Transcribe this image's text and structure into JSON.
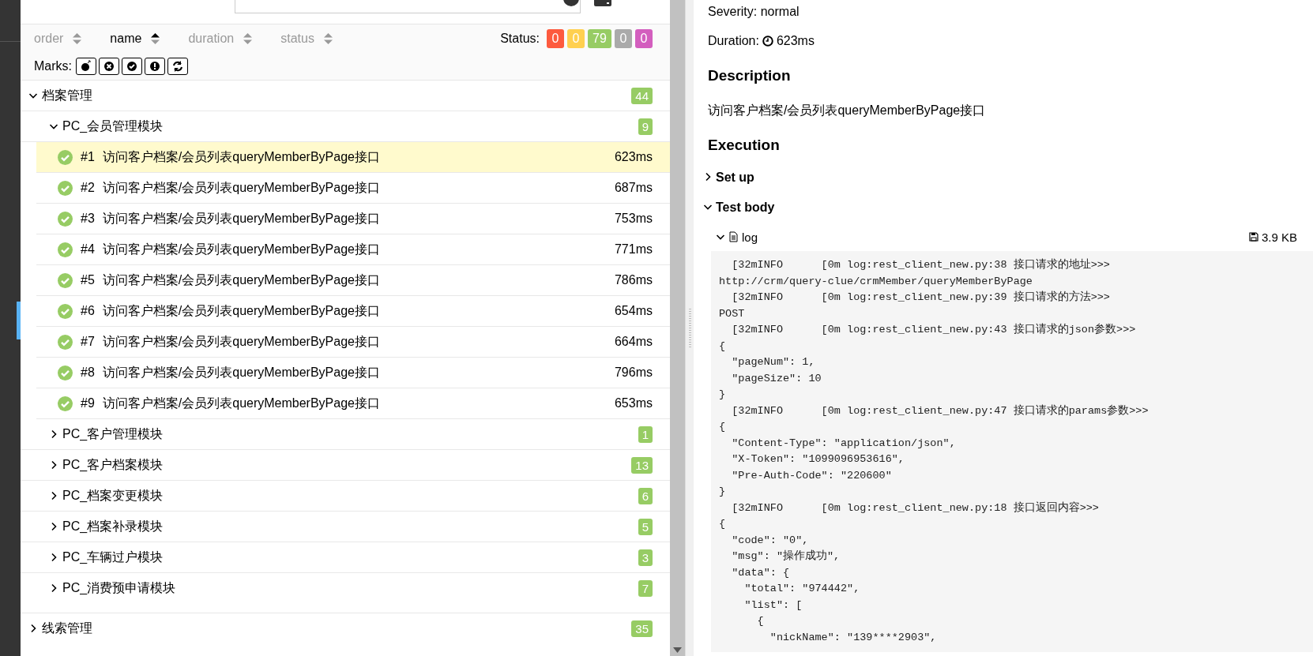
{
  "sorters": [
    {
      "label": "order",
      "selected": false
    },
    {
      "label": "name",
      "selected": true
    },
    {
      "label": "duration",
      "selected": false
    },
    {
      "label": "status",
      "selected": false
    }
  ],
  "status_filter": {
    "label": "Status:",
    "counts": [
      {
        "value": "0",
        "color": "#fd5a3e"
      },
      {
        "value": "0",
        "color": "#ffd050"
      },
      {
        "value": "79",
        "color": "#97cc64"
      },
      {
        "value": "0",
        "color": "#aaaaaa"
      },
      {
        "value": "0",
        "color": "#d35ebe"
      }
    ]
  },
  "marks": {
    "label": "Marks:",
    "buttons": [
      {
        "kind": "flaky"
      },
      {
        "kind": "new-failed"
      },
      {
        "kind": "new-passed"
      },
      {
        "kind": "new-broken"
      },
      {
        "kind": "retries"
      }
    ]
  },
  "tree": [
    {
      "name": "档案管理",
      "count": "44",
      "expanded": true,
      "children": [
        {
          "name": "PC_会员管理模块",
          "count": "9",
          "expanded": true,
          "tests": [
            {
              "index": "#1",
              "name": "访问客户档案/会员列表queryMemberByPage接口",
              "duration": "623ms",
              "kind": "passed",
              "selected": true
            },
            {
              "index": "#2",
              "name": "访问客户档案/会员列表queryMemberByPage接口",
              "duration": "687ms",
              "kind": "passed",
              "selected": false
            },
            {
              "index": "#3",
              "name": "访问客户档案/会员列表queryMemberByPage接口",
              "duration": "753ms",
              "kind": "passed",
              "selected": false
            },
            {
              "index": "#4",
              "name": "访问客户档案/会员列表queryMemberByPage接口",
              "duration": "771ms",
              "kind": "passed",
              "selected": false
            },
            {
              "index": "#5",
              "name": "访问客户档案/会员列表queryMemberByPage接口",
              "duration": "786ms",
              "kind": "passed",
              "selected": false
            },
            {
              "index": "#6",
              "name": "访问客户档案/会员列表queryMemberByPage接口",
              "duration": "654ms",
              "kind": "passed",
              "selected": false
            },
            {
              "index": "#7",
              "name": "访问客户档案/会员列表queryMemberByPage接口",
              "duration": "664ms",
              "kind": "passed",
              "selected": false
            },
            {
              "index": "#8",
              "name": "访问客户档案/会员列表queryMemberByPage接口",
              "duration": "796ms",
              "kind": "passed",
              "selected": false
            },
            {
              "index": "#9",
              "name": "访问客户档案/会员列表queryMemberByPage接口",
              "duration": "653ms",
              "kind": "passed",
              "selected": false
            }
          ]
        },
        {
          "name": "PC_客户管理模块",
          "count": "1",
          "expanded": false
        },
        {
          "name": "PC_客户档案模块",
          "count": "13",
          "expanded": false
        },
        {
          "name": "PC_档案变更模块",
          "count": "6",
          "expanded": false
        },
        {
          "name": "PC_档案补录模块",
          "count": "5",
          "expanded": false
        },
        {
          "name": "PC_车辆过户模块",
          "count": "3",
          "expanded": false
        },
        {
          "name": "PC_消费预申请模块",
          "count": "7",
          "expanded": false
        }
      ]
    },
    {
      "name": "线索管理",
      "count": "35",
      "expanded": false
    }
  ],
  "detail": {
    "severity": "Severity: normal",
    "duration_label": "Duration:",
    "duration": "623ms",
    "description_heading": "Description",
    "description": "访问客户档案/会员列表queryMemberByPage接口",
    "execution_heading": "Execution",
    "steps": [
      {
        "name": "Set up",
        "expanded": false
      },
      {
        "name": "Test body",
        "expanded": true
      }
    ],
    "attachment": {
      "name": "log",
      "size": "3.9 KB",
      "expanded": true,
      "lines": [
        "  [32mINFO      [0m log:rest_client_new.py:38 接口请求的地址>>>",
        "http://crm/query-clue/crmMember/queryMemberByPage",
        "  [32mINFO      [0m log:rest_client_new.py:39 接口请求的方法>>>",
        "POST",
        "  [32mINFO      [0m log:rest_client_new.py:43 接口请求的json参数>>>",
        "{",
        "  \"pageNum\": 1,",
        "  \"pageSize\": 10",
        "}",
        "  [32mINFO      [0m log:rest_client_new.py:47 接口请求的params参数>>>",
        "{",
        "  \"Content-Type\": \"application/json\",",
        "  \"X-Token\": \"1099096953616\",",
        "  \"Pre-Auth-Code\": \"220600\"",
        "}",
        "  [32mINFO      [0m log:rest_client_new.py:18 接口返回内容>>>",
        "{",
        "  \"code\": \"0\",",
        "  \"msg\": \"操作成功\",",
        "  \"data\": {",
        "    \"total\": \"974442\",",
        "    \"list\": [",
        "      {",
        "        \"nickName\": \"139****2903\","
      ]
    }
  }
}
